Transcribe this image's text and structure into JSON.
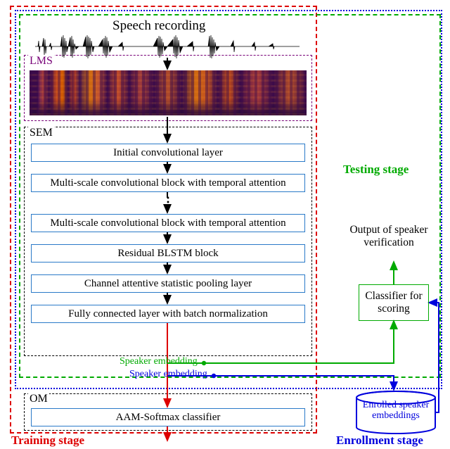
{
  "title": "Speech recording",
  "modules": {
    "lms": "LMS",
    "sem": "SEM",
    "om": "OM"
  },
  "layers": {
    "initial_conv": "Initial convolutional layer",
    "mscb1": "Multi-scale convolutional block with temporal attention",
    "mscb2": "Multi-scale convolutional block with temporal attention",
    "res_blstm": "Residual BLSTM block",
    "casp": "Channel attentive statistic pooling layer",
    "fc_bn": "Fully connected layer with batch normalization",
    "aam": "AAM-Softmax classifier"
  },
  "stages": {
    "testing": "Testing stage",
    "enrollment": "Enrollment stage",
    "training": "Training stage"
  },
  "right": {
    "output": "Output of speaker verification",
    "classifier": "Classifier for scoring",
    "db": "Enrolled speaker embeddings"
  },
  "embedding": {
    "test": "Speaker embedding",
    "enroll": "Speaker embedding"
  },
  "colors": {
    "training": "#d00000",
    "enrollment": "#0000d0",
    "testing": "#00a000",
    "lms": "#700070",
    "block_border": "#2a7ac8"
  },
  "chart_data": {
    "type": "diagram",
    "flow": [
      "Speech recording (waveform)",
      "LMS → log-mel spectrogram",
      "SEM: Initial convolutional layer",
      "SEM: Multi-scale convolutional block with temporal attention (×N)",
      "SEM: Residual BLSTM block",
      "SEM: Channel attentive statistic pooling layer",
      "SEM: Fully connected layer with batch normalization",
      "→ Speaker embedding",
      "OM: AAM-Softmax classifier"
    ],
    "branches": {
      "testing": "Speaker embedding → Classifier for scoring → Output of speaker verification",
      "enrollment": "Speaker embedding → Enrolled speaker embeddings (database) → Classifier for scoring",
      "training": "Speaker embedding → AAM-Softmax classifier"
    },
    "stage_colors": {
      "Training": "red",
      "Enrollment": "blue",
      "Testing": "green"
    }
  }
}
